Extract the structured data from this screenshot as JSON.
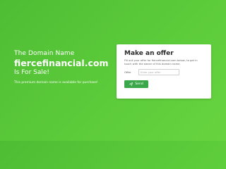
{
  "hero": {
    "line1": "The Domain Name",
    "domain": "fiercefinancial.com",
    "line3": "Is For Sale!",
    "note": "This premium domain name is available for purchase!"
  },
  "offer": {
    "title": "Make an offer",
    "description": "Fill out your offer for fiercefinancial.com below, to get in touch with the owner of this domain name.",
    "offer_label": "Offer",
    "offer_placeholder": "Enter your offer",
    "offer_value": "",
    "send_label": "Send",
    "send_icon": "paper-plane-icon"
  },
  "colors": {
    "background_start": "#4fbd34",
    "background_end": "#67d43f",
    "button": "#3aa84a"
  }
}
